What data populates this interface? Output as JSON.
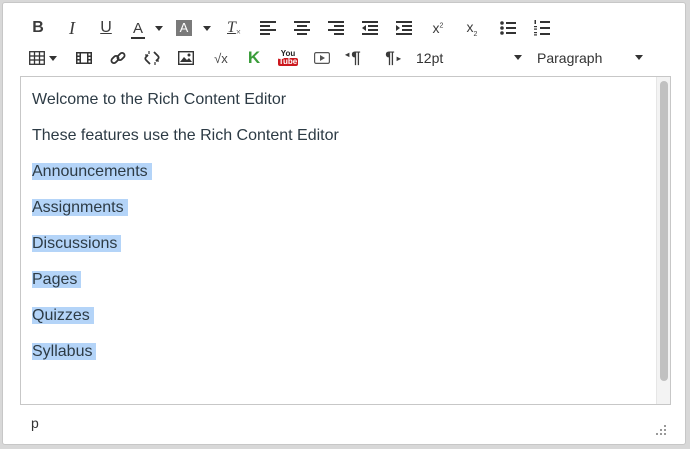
{
  "toolbar": {
    "row1": [
      {
        "name": "bold-icon",
        "glyph": "B"
      },
      {
        "name": "italic-icon",
        "glyph": "I"
      },
      {
        "name": "underline-icon",
        "glyph": "U"
      },
      {
        "name": "font-color-icon",
        "glyph": "A"
      },
      {
        "name": "background-color-icon",
        "glyph": "A"
      },
      {
        "name": "clear-formatting-icon",
        "glyph": "T"
      },
      {
        "name": "align-left-icon"
      },
      {
        "name": "align-center-icon"
      },
      {
        "name": "align-right-icon"
      },
      {
        "name": "outdent-icon"
      },
      {
        "name": "indent-icon"
      },
      {
        "name": "superscript-icon",
        "glyph": "x",
        "sup": "2"
      },
      {
        "name": "subscript-icon",
        "glyph": "x",
        "sub": "2"
      },
      {
        "name": "bullet-list-icon"
      },
      {
        "name": "numbered-list-icon"
      }
    ],
    "row2": [
      {
        "name": "table-icon"
      },
      {
        "name": "media-icon"
      },
      {
        "name": "link-icon"
      },
      {
        "name": "unlink-icon"
      },
      {
        "name": "image-icon"
      },
      {
        "name": "equation-icon",
        "glyph": "√x"
      },
      {
        "name": "kaltura-icon",
        "glyph": "K"
      },
      {
        "name": "youtube-icon",
        "glyph_top": "You",
        "glyph_bottom": "Tube"
      },
      {
        "name": "video-icon"
      },
      {
        "name": "ltr-paragraph-icon",
        "glyph": "¶"
      },
      {
        "name": "rtl-paragraph-icon",
        "glyph": "¶"
      }
    ],
    "font_size": "12pt",
    "block_format": "Paragraph"
  },
  "content": {
    "paragraphs": [
      {
        "text": "Welcome to the Rich Content Editor",
        "selected": false
      },
      {
        "text": "These features use the Rich Content Editor",
        "selected": false
      },
      {
        "text": "Announcements",
        "selected": true
      },
      {
        "text": "Assignments",
        "selected": true
      },
      {
        "text": "Discussions",
        "selected": true
      },
      {
        "text": "Pages",
        "selected": true
      },
      {
        "text": "Quizzes",
        "selected": true
      },
      {
        "text": "Syllabus",
        "selected": true
      }
    ]
  },
  "statusbar": {
    "path": "p"
  },
  "colors": {
    "selection": "#b4d4f8",
    "text": "#2d3b45",
    "youtube_red": "#cc181e",
    "kaltura_green": "#3b9d3b"
  }
}
